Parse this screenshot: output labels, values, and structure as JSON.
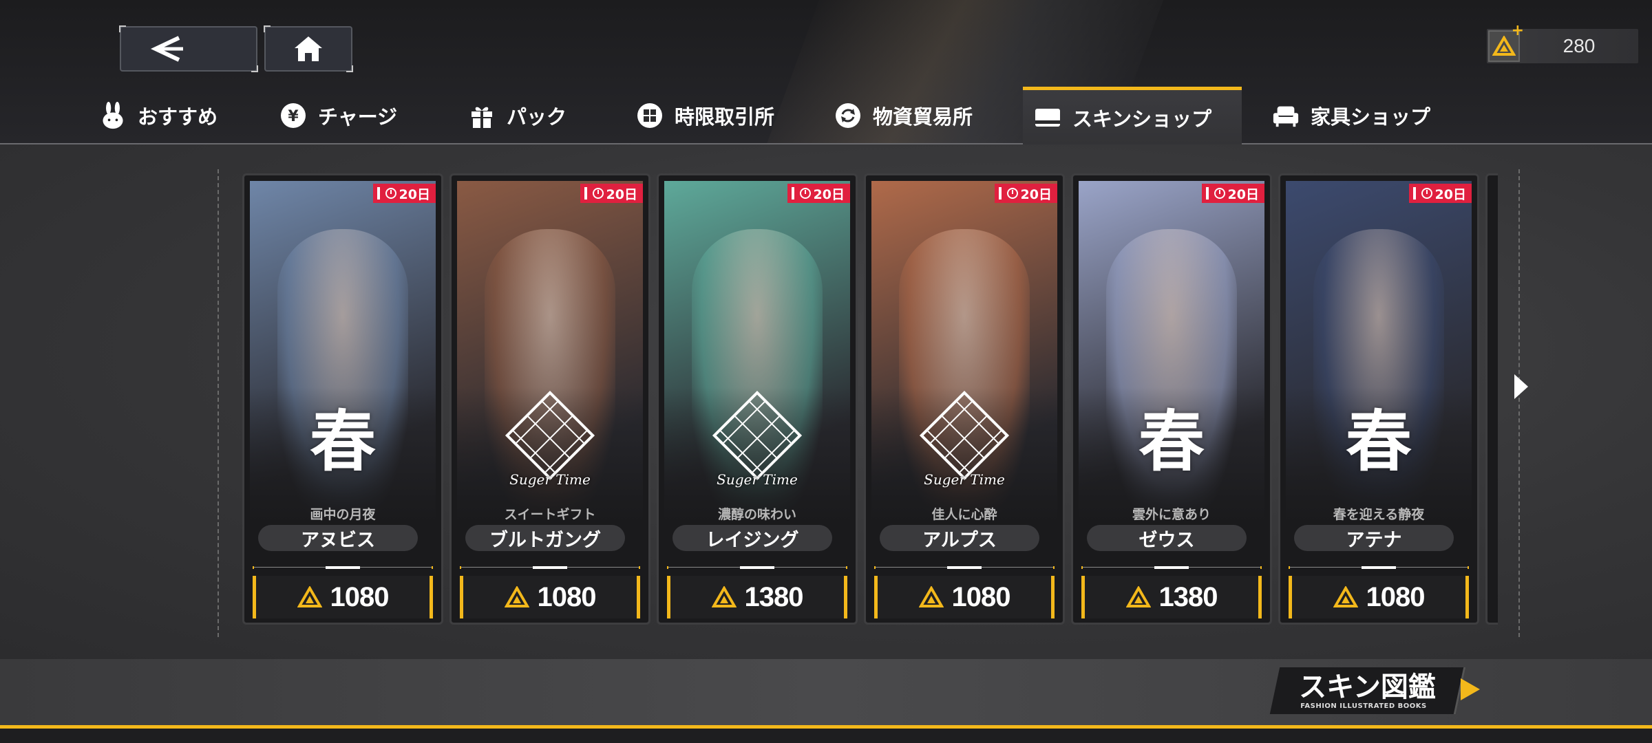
{
  "currency": {
    "amount": "280",
    "icon": "premium-gem-icon",
    "add_icon": "plus-icon"
  },
  "nav": {
    "back_icon": "back-arrow-icon",
    "home_icon": "home-icon"
  },
  "tabs": [
    {
      "label": "おすすめ",
      "icon": "bunny-icon",
      "active": false
    },
    {
      "label": "チャージ",
      "icon": "yen-icon",
      "active": false
    },
    {
      "label": "パック",
      "icon": "gift-icon",
      "active": false
    },
    {
      "label": "時限取引所",
      "icon": "grid-icon",
      "active": false
    },
    {
      "label": "物資貿易所",
      "icon": "exchange-icon",
      "active": false
    },
    {
      "label": "スキンショップ",
      "icon": "card-icon",
      "active": true
    },
    {
      "label": "家具ショップ",
      "icon": "sofa-icon",
      "active": false
    }
  ],
  "skins": [
    {
      "subtitle": "画中の月夜",
      "name": "アヌビス",
      "price": "1080",
      "timer": "20日",
      "emblem": "春",
      "emblem_type": "spring",
      "tint": "#6f86a8"
    },
    {
      "subtitle": "スイートギフト",
      "name": "ブルトガング",
      "price": "1080",
      "timer": "20日",
      "emblem": "Suger Time",
      "emblem_type": "sugar",
      "tint": "#8a5a44"
    },
    {
      "subtitle": "濃醇の味わい",
      "name": "レイジング",
      "price": "1380",
      "timer": "20日",
      "emblem": "Suger Time",
      "emblem_type": "sugar",
      "tint": "#5ea99a"
    },
    {
      "subtitle": "佳人に心酔",
      "name": "アルプス",
      "price": "1080",
      "timer": "20日",
      "emblem": "Suger Time",
      "emblem_type": "sugar",
      "tint": "#b06a4a"
    },
    {
      "subtitle": "雲外に意あり",
      "name": "ゼウス",
      "price": "1380",
      "timer": "20日",
      "emblem": "春",
      "emblem_type": "spring",
      "tint": "#9aa4c8"
    },
    {
      "subtitle": "春を迎える静夜",
      "name": "アテナ",
      "price": "1080",
      "timer": "20日",
      "emblem": "春",
      "emblem_type": "spring",
      "tint": "#3c4a6e"
    }
  ],
  "bottom": {
    "book_title": "スキン図鑑",
    "book_subtitle": "FASHION ILLUSTRATED BOOKS"
  },
  "colors": {
    "accent": "#f3b81b",
    "badge": "#e0203f"
  }
}
